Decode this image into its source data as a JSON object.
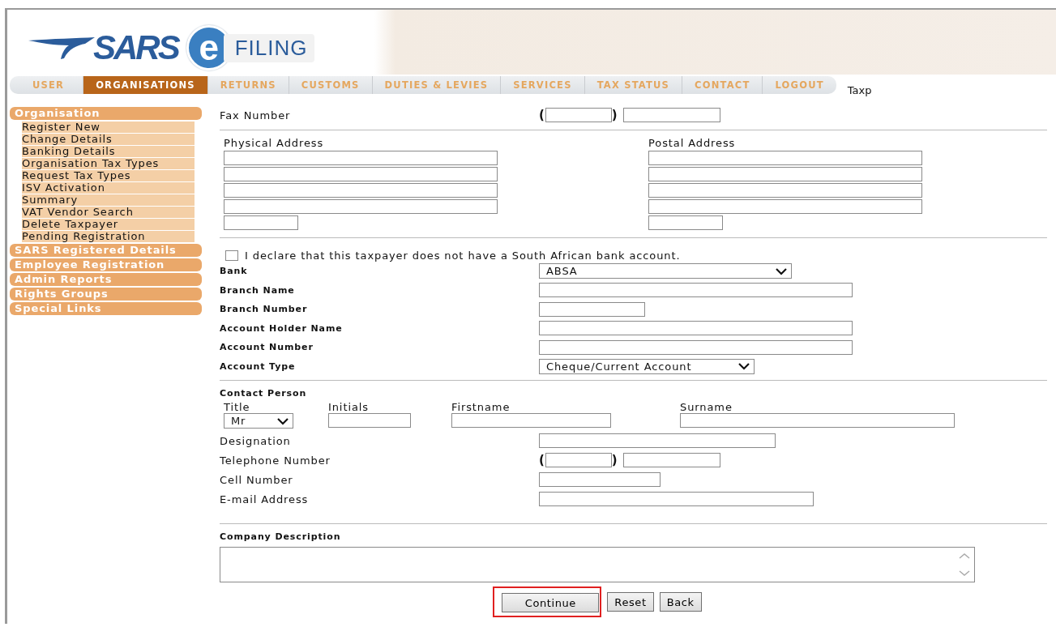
{
  "logo": {
    "brand": "SARS",
    "e_letter": "e",
    "product": "FILING"
  },
  "nav": {
    "tabs": [
      {
        "label": "USER",
        "selected": false
      },
      {
        "label": "ORGANISATIONS",
        "selected": true
      },
      {
        "label": "RETURNS",
        "selected": false
      },
      {
        "label": "CUSTOMS",
        "selected": false
      },
      {
        "label": "DUTIES & LEVIES",
        "selected": false
      },
      {
        "label": "SERVICES",
        "selected": false
      },
      {
        "label": "TAX STATUS",
        "selected": false
      },
      {
        "label": "CONTACT",
        "selected": false
      },
      {
        "label": "LOGOUT",
        "selected": false
      }
    ],
    "trailing_text": "Taxp"
  },
  "sidebar": {
    "groups": [
      {
        "title": "Organisation",
        "items": [
          "Register New",
          "Change Details",
          "Banking Details",
          "Organisation Tax Types",
          "Request Tax Types",
          "ISV Activation",
          "Summary",
          "VAT Vendor Search",
          "Delete Taxpayer",
          "Pending Registration"
        ]
      },
      {
        "title": "SARS Registered Details"
      },
      {
        "title": "Employee Registration"
      },
      {
        "title": "Admin Reports"
      },
      {
        "title": "Rights Groups"
      },
      {
        "title": "Special Links"
      }
    ]
  },
  "form": {
    "fax": {
      "label": "Fax Number",
      "kind": "phone",
      "open": "(",
      "close": ")"
    },
    "addresses": [
      {
        "heading": "Physical Address"
      },
      {
        "heading": "Postal Address"
      }
    ],
    "declaration": {
      "text": "I declare that this taxpayer does not have a South African bank account.",
      "checked": false
    },
    "bank_fields": [
      {
        "label": "Bank",
        "kind": "select",
        "value": "ABSA"
      },
      {
        "label": "Branch Name",
        "kind": "text"
      },
      {
        "label": "Branch Number",
        "kind": "text"
      },
      {
        "label": "Account Holder Name",
        "kind": "text"
      },
      {
        "label": "Account Number",
        "kind": "text"
      },
      {
        "label": "Account Type",
        "kind": "select",
        "value": "Cheque/Current Account"
      }
    ],
    "contact": {
      "heading": "Contact Person",
      "name_fields": [
        {
          "label": "Title",
          "kind": "select",
          "value": "Mr"
        },
        {
          "label": "Initials",
          "kind": "text"
        },
        {
          "label": "Firstname",
          "kind": "text"
        },
        {
          "label": "Surname",
          "kind": "text"
        }
      ],
      "fields": [
        {
          "label": "Designation",
          "kind": "text"
        },
        {
          "label": "Telephone Number",
          "kind": "phone",
          "open": "(",
          "close": ")"
        },
        {
          "label": "Cell Number",
          "kind": "text"
        },
        {
          "label": "E-mail Address",
          "kind": "text"
        }
      ]
    },
    "description": {
      "label": "Company Description"
    },
    "buttons": [
      {
        "label": "Continue",
        "highlighted": true
      },
      {
        "label": "Reset",
        "highlighted": false
      },
      {
        "label": "Back",
        "highlighted": false
      }
    ]
  }
}
